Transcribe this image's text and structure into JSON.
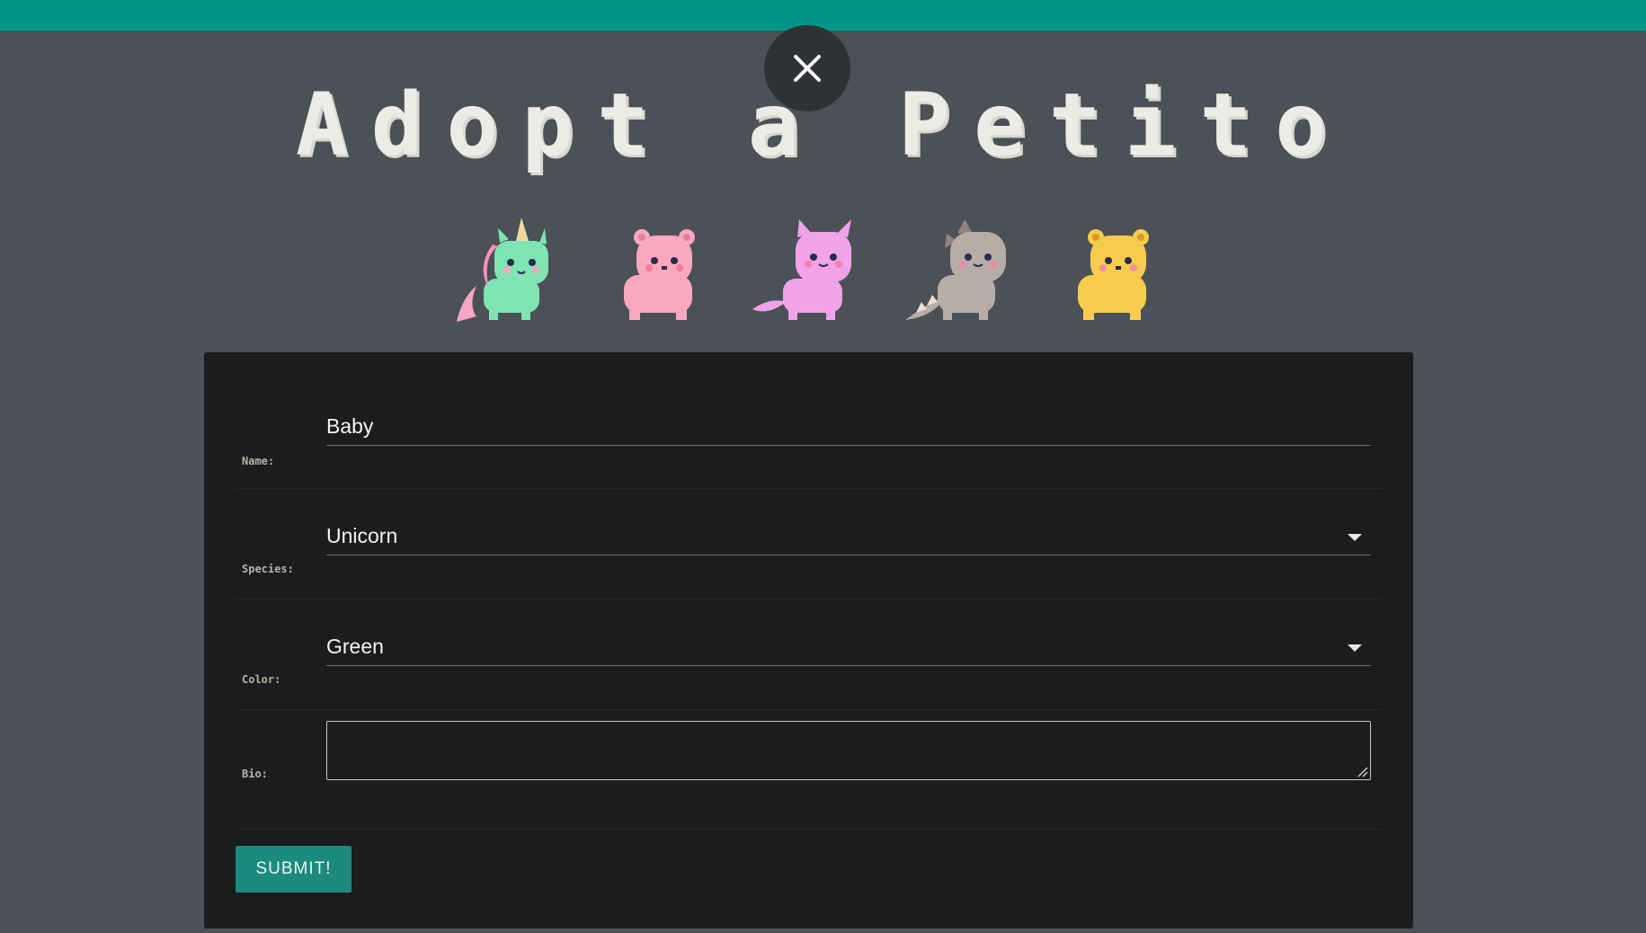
{
  "app": {
    "title": "Adopt a Petito",
    "accent": "#009688"
  },
  "pets": [
    {
      "name": "unicorn"
    },
    {
      "name": "pink-bear"
    },
    {
      "name": "cat"
    },
    {
      "name": "dino"
    },
    {
      "name": "yellow-bear"
    }
  ],
  "form": {
    "name": {
      "label": "Name:",
      "value": "Baby"
    },
    "species": {
      "label": "Species:",
      "value": "Unicorn"
    },
    "color": {
      "label": "Color:",
      "value": "Green"
    },
    "bio": {
      "label": "Bio:",
      "value": ""
    },
    "submit_label": "SUBMIT!"
  }
}
